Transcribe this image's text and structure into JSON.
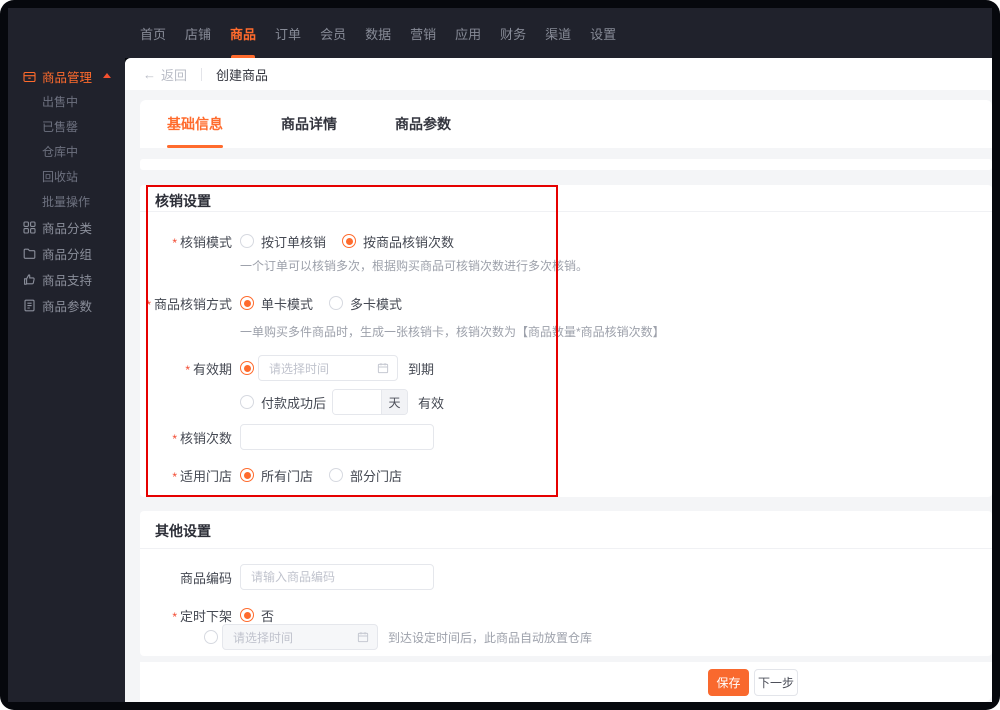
{
  "colors": {
    "accent": "#ff6b2d",
    "annotation_red": "#e60000",
    "dark_chrome": "#20222c"
  },
  "ui": {
    "required_mark": "*",
    "back_arrow": "←"
  },
  "topnav": {
    "items": [
      {
        "label": "首页",
        "active": false
      },
      {
        "label": "店铺",
        "active": false
      },
      {
        "label": "商品",
        "active": true
      },
      {
        "label": "订单",
        "active": false
      },
      {
        "label": "会员",
        "active": false
      },
      {
        "label": "数据",
        "active": false
      },
      {
        "label": "营销",
        "active": false
      },
      {
        "label": "应用",
        "active": false
      },
      {
        "label": "财务",
        "active": false
      },
      {
        "label": "渠道",
        "active": false
      },
      {
        "label": "设置",
        "active": false
      }
    ]
  },
  "sidebar": {
    "root": {
      "label": "商品管理",
      "active": true,
      "expanded": true
    },
    "submenu": [
      {
        "label": "出售中"
      },
      {
        "label": "已售罄"
      },
      {
        "label": "仓库中"
      },
      {
        "label": "回收站"
      },
      {
        "label": "批量操作"
      }
    ],
    "items": [
      {
        "label": "商品分类",
        "icon": "grid-icon"
      },
      {
        "label": "商品分组",
        "icon": "folder-icon"
      },
      {
        "label": "商品支持",
        "icon": "thumb-up-icon"
      },
      {
        "label": "商品参数",
        "icon": "document-icon"
      }
    ]
  },
  "breadcrumb": {
    "back_label": "返回",
    "title": "创建商品"
  },
  "tabs": [
    {
      "label": "基础信息",
      "active": true
    },
    {
      "label": "商品详情",
      "active": false
    },
    {
      "label": "商品参数",
      "active": false
    }
  ],
  "verify_section": {
    "title": "核销设置",
    "mode": {
      "label": "核销模式",
      "required": true,
      "options": [
        {
          "label": "按订单核销",
          "selected": false
        },
        {
          "label": "按商品核销次数",
          "selected": true
        }
      ],
      "help": "一个订单可以核销多次，根据购买商品可核销次数进行多次核销。"
    },
    "card_mode": {
      "label": "商品核销方式",
      "required": true,
      "options": [
        {
          "label": "单卡模式",
          "selected": true
        },
        {
          "label": "多卡模式",
          "selected": false
        }
      ],
      "help": "一单购买多件商品时，生成一张核销卡，核销次数为【商品数量*商品核销次数】"
    },
    "validity": {
      "label": "有效期",
      "required": true,
      "date_option": {
        "selected": true,
        "placeholder": "请选择时间",
        "suffix": "到期"
      },
      "days_option": {
        "selected": false,
        "label": "付款成功后",
        "value": "",
        "unit": "天",
        "suffix": "有效"
      }
    },
    "count": {
      "label": "核销次数",
      "required": true,
      "value": ""
    },
    "stores": {
      "label": "适用门店",
      "required": true,
      "options": [
        {
          "label": "所有门店",
          "selected": true
        },
        {
          "label": "部分门店",
          "selected": false
        }
      ]
    }
  },
  "other_section": {
    "title": "其他设置",
    "code": {
      "label": "商品编码",
      "required": false,
      "placeholder": "请输入商品编码",
      "value": ""
    },
    "schedule": {
      "label": "定时下架",
      "required": true,
      "no_option": {
        "label": "否",
        "selected": true
      },
      "time_option": {
        "selected": false,
        "placeholder": "请选择时间",
        "note": "到达设定时间后，此商品自动放置仓库"
      }
    }
  },
  "footer": {
    "save_label": "保存",
    "next_label": "下一步"
  }
}
